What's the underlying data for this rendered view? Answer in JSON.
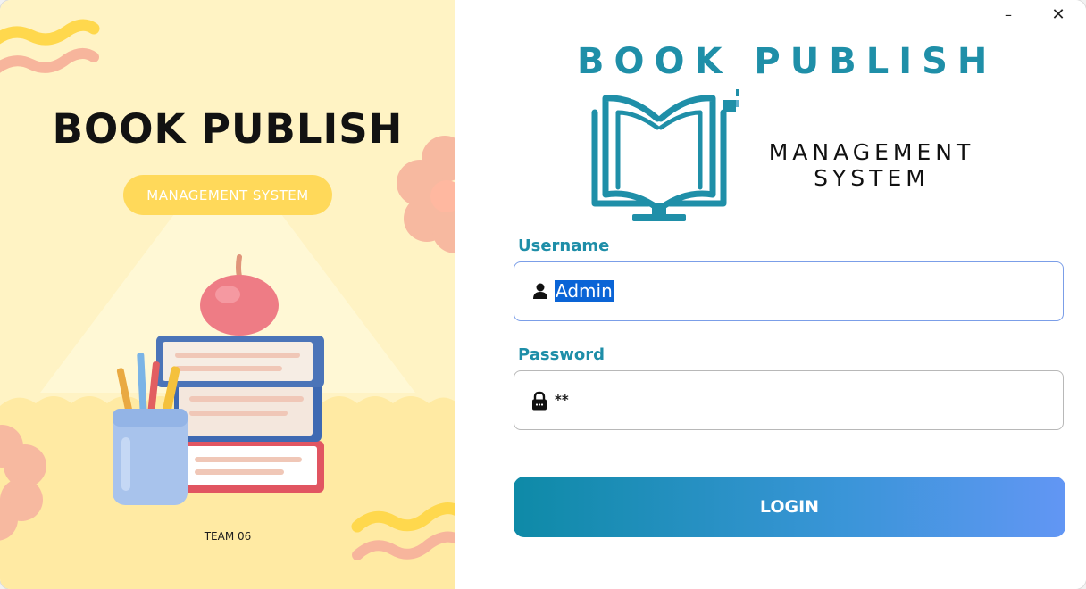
{
  "window": {
    "controls": {
      "minimize_label": "–",
      "close_label": "✕"
    }
  },
  "poster": {
    "title": "BOOK PUBLISH",
    "subtitle": "MANAGEMENT SYSTEM",
    "team": "TEAM 06",
    "background_color": "#fff3c4",
    "accent_color": "#ffd95a"
  },
  "brand": {
    "title": "BOOK PUBLISH",
    "subtitle_line1": "MANAGEMENT",
    "subtitle_line2": "SYSTEM",
    "logo_icon": "open-book-monitor-icon",
    "brand_color": "#1f8fa8"
  },
  "form": {
    "username": {
      "label": "Username",
      "value": "Admin",
      "icon": "user-icon",
      "selected": true
    },
    "password": {
      "label": "Password",
      "value": "**",
      "icon": "lock-icon"
    },
    "submit": {
      "label": "LOGIN"
    }
  }
}
